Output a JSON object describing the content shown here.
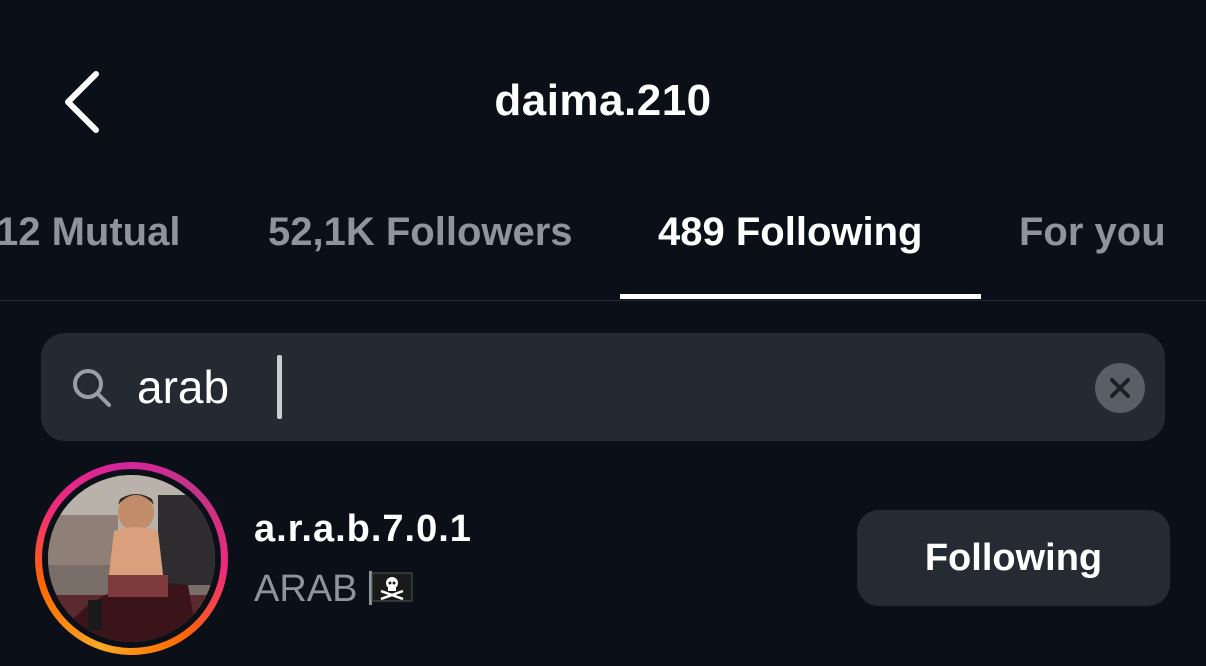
{
  "header": {
    "title": "daima.210",
    "back_icon": "chevron-left-icon"
  },
  "tabs": [
    {
      "label": "12 Mutual",
      "active": false
    },
    {
      "label": "52,1K Followers",
      "active": false
    },
    {
      "label": "489 Following",
      "active": true
    },
    {
      "label": "For you",
      "active": false
    }
  ],
  "search": {
    "value": "arab",
    "icon": "search-icon",
    "clear_icon": "clear-icon"
  },
  "results": [
    {
      "username": "a.r.a.b.7.0.1",
      "full_name": "ARAB",
      "flag_icon": "pirate-flag-icon",
      "button_label": "Following",
      "story_ring": true
    }
  ],
  "colors": {
    "background": "#0b0f17",
    "search_bg": "#252932",
    "button_bg": "#262a33",
    "muted_text": "#8e939c",
    "active_text": "#ffffff"
  }
}
